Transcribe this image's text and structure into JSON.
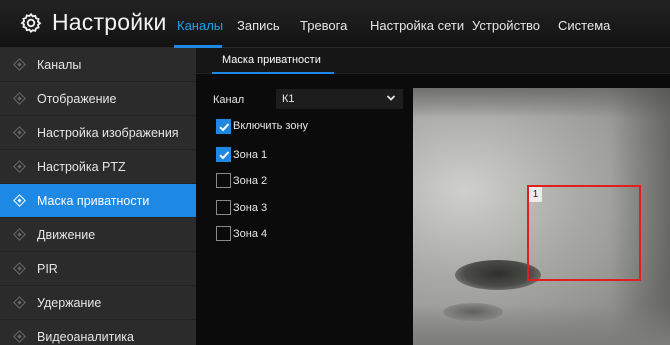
{
  "header": {
    "title": "Настройки",
    "nav": [
      {
        "label": "Каналы",
        "active": true
      },
      {
        "label": "Запись",
        "active": false
      },
      {
        "label": "Тревога",
        "active": false
      },
      {
        "label": "Настройка сети",
        "active": false
      },
      {
        "label": "Устройство",
        "active": false
      },
      {
        "label": "Система",
        "active": false
      }
    ]
  },
  "sidebar": {
    "items": [
      {
        "label": "Каналы",
        "active": false
      },
      {
        "label": "Отображение",
        "active": false
      },
      {
        "label": "Настройка изображения",
        "active": false
      },
      {
        "label": "Настройка PTZ",
        "active": false
      },
      {
        "label": "Маска приватности",
        "active": true
      },
      {
        "label": "Движение",
        "active": false
      },
      {
        "label": "PIR",
        "active": false
      },
      {
        "label": "Удержание",
        "active": false
      },
      {
        "label": "Видеоаналитика",
        "active": false
      }
    ]
  },
  "main": {
    "subtab": "Маска приватности",
    "channel": {
      "label": "Канал",
      "value": "К1"
    },
    "enable_zone": {
      "label": "Включить зону",
      "checked": true
    },
    "zones": [
      {
        "label": "Зона 1",
        "checked": true
      },
      {
        "label": "Зона 2",
        "checked": false
      },
      {
        "label": "Зона 3",
        "checked": false
      },
      {
        "label": "Зона 4",
        "checked": false
      }
    ],
    "video": {
      "zone_label": "1"
    }
  },
  "colors": {
    "accent": "#1e88e5",
    "zone_border": "#e02020"
  },
  "icons": {
    "settings": "gear-icon",
    "dropdown": "chevron-down-icon",
    "check": "check-icon",
    "bullet": "diamond-bullet-icon"
  }
}
